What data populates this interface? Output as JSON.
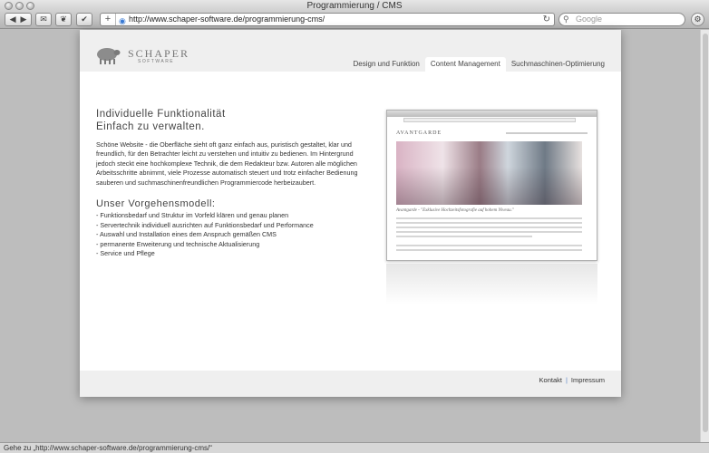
{
  "window": {
    "title": "Programmierung / CMS"
  },
  "toolbar": {
    "url": "http://www.schaper-software.de/programmierung-cms/",
    "search_placeholder": "Google",
    "back_icon": "back-arrow-icon",
    "forward_icon": "forward-arrow-icon"
  },
  "header": {
    "logo_name": "SCHAPER",
    "logo_sub": "SOFTWARE",
    "tabs": [
      {
        "label": "Design und Funktion"
      },
      {
        "label": "Content Management"
      },
      {
        "label": "Suchmaschinen-Optimierung"
      }
    ],
    "active_tab": "Content Management"
  },
  "content": {
    "heading_line1": "Individuelle Funktionalität",
    "heading_line2": "Einfach zu verwalten.",
    "paragraph": "Schöne Website - die Oberfläche sieht oft ganz einfach aus, puristisch gestaltet, klar und freundlich, für den Betrachter leicht zu verstehen und intuitiv zu bedienen. Im Hintergrund jedoch steckt eine hochkomplexe Technik, die dem Redakteur bzw. Autoren alle möglichen Arbeitsschritte abnimmt, viele Prozesse automatisch steuert und trotz einfacher Bedienung sauberen und suchmaschinenfreundlichen Programmiercode herbeizaubert.",
    "subheading": "Unser Vorgehensmodell:",
    "list": [
      "- Funktionsbedarf und Struktur im Vorfeld klären und genau planen",
      "- Servertechnik individuell ausrichten auf Funktionsbedarf und Performance",
      "- Auswahl und Installation eines dem Anspruch gemäßen CMS",
      "- permanente Erweiterung und technische Aktualisierung",
      "- Service und Pflege"
    ]
  },
  "preview": {
    "logo": "AVANTGARDE",
    "caption": "Avantgarde - \"Exklusive Hochzeitsfotografie auf hohem Niveau.\""
  },
  "footer": {
    "kontakt": "Kontakt",
    "separator": "|",
    "impressum": "Impressum"
  },
  "statusbar": {
    "text": "Gehe zu „http://www.schaper-software.de/programmierung-cms/“"
  },
  "colors": {
    "page_bg": "#bdbdbd",
    "header_bg": "#efefef",
    "footer_separator": "#5b86c7"
  }
}
